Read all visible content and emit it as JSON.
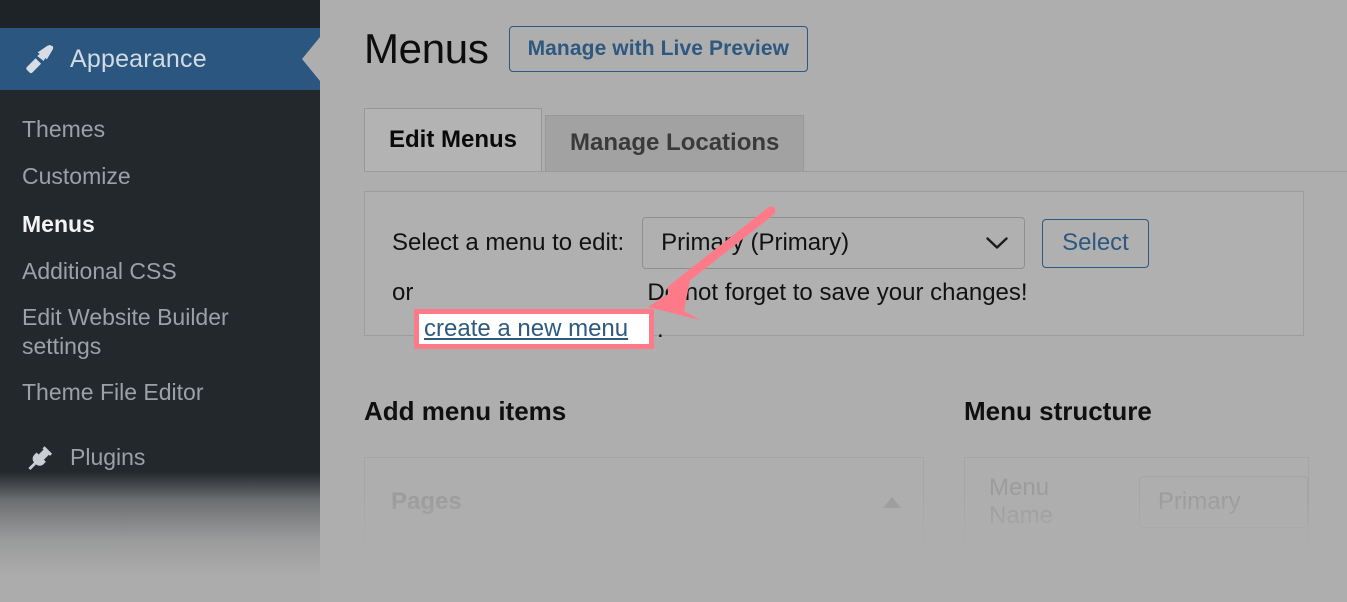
{
  "sidebar": {
    "active_section": {
      "label": "Appearance",
      "icon": "paintbrush-icon",
      "background_color": "#2a567f"
    },
    "items": [
      {
        "label": "Themes",
        "current": false
      },
      {
        "label": "Customize",
        "current": false
      },
      {
        "label": "Menus",
        "current": true
      },
      {
        "label": "Additional CSS",
        "current": false
      },
      {
        "label": "Edit Website Builder settings",
        "current": false
      },
      {
        "label": "Theme File Editor",
        "current": false
      }
    ],
    "faded_item": {
      "label": "Plugins",
      "icon": "plug-icon"
    }
  },
  "main": {
    "page_title": "Menus",
    "live_preview_button": "Manage with Live Preview",
    "tabs": [
      {
        "label": "Edit Menus",
        "active": true
      },
      {
        "label": "Manage Locations",
        "active": false
      }
    ],
    "select_panel": {
      "label": "Select a menu to edit:",
      "select_value": "Primary (Primary)",
      "select_icon": "chevron-down-icon",
      "select_button": "Select",
      "or_text": "or",
      "create_link": "create a new menu",
      "period": ".",
      "reminder": "Do not forget to save your changes!"
    },
    "columns": [
      {
        "heading": "Add menu items",
        "accordion_label": "Pages",
        "accordion_icon": "caret-up-icon"
      },
      {
        "heading": "Menu structure",
        "field_label": "Menu Name",
        "field_value": "Primary"
      }
    ]
  },
  "annotation": {
    "highlight_color": "#ff7a88",
    "arrow_color": "#ff7a88",
    "highlighted_text": "create a new menu",
    "arrow_from": "771,211",
    "arrow_to": "650,305"
  }
}
